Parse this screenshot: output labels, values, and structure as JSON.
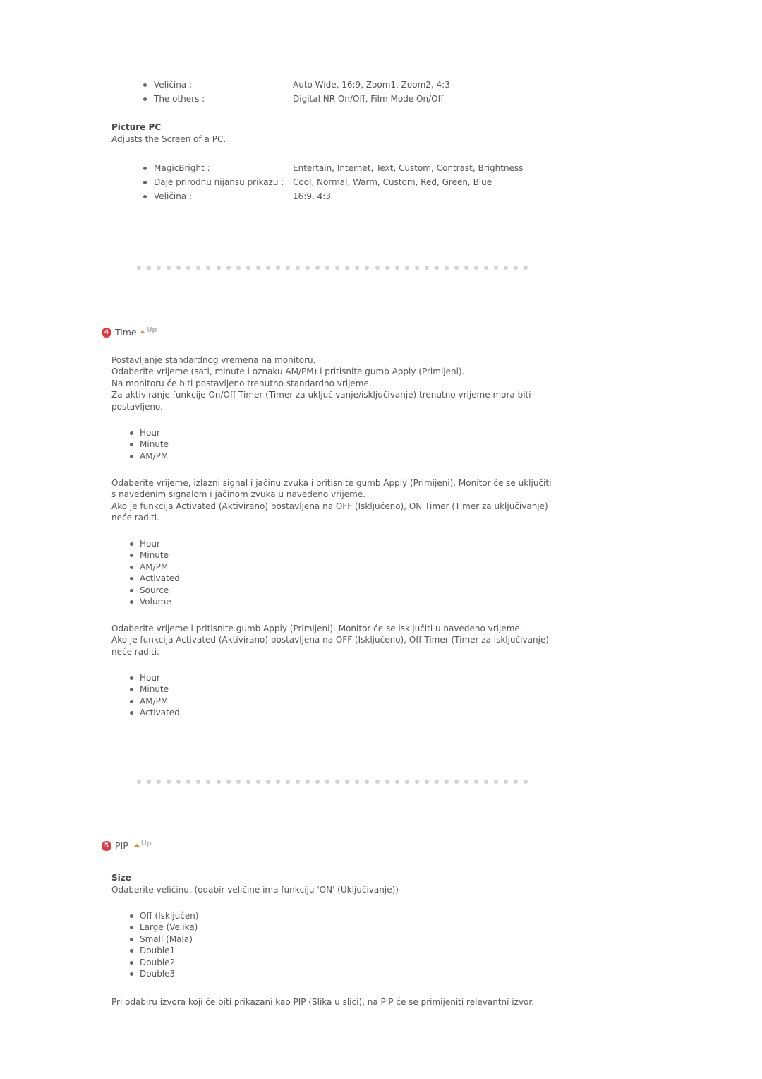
{
  "picture_top": {
    "items": [
      {
        "label": "Veličina :",
        "value": "Auto Wide, 16:9, Zoom1, Zoom2, 4:3"
      },
      {
        "label": "The others :",
        "value": "Digital NR On/Off, Film Mode On/Off"
      }
    ]
  },
  "picture_pc": {
    "title": "Picture PC",
    "description": "Adjusts the Screen of a PC.",
    "items": [
      {
        "label": "MagicBright :",
        "value": "Entertain, Internet, Text, Custom, Contrast, Brightness"
      },
      {
        "label": "Daje prirodnu nijansu prikazu :",
        "value": "Cool, Normal, Warm, Custom, Red, Green, Blue"
      },
      {
        "label": "Veličina :",
        "value": "16:9, 4:3"
      }
    ]
  },
  "time_section": {
    "number": "4",
    "title": "Time",
    "up_label": "Up",
    "intro": [
      "Postavljanje standardnog vremena na monitoru.",
      "Odaberite vrijeme (sati, minute i oznaku AM/PM) i pritisnite gumb Apply (Primijeni).",
      "Na monitoru će biti postavljeno trenutno standardno vrijeme.",
      "Za aktiviranje funkcije On/Off Timer (Timer za uključivanje/isključivanje) trenutno vrijeme mora biti postavljeno."
    ],
    "list1": [
      "Hour",
      "Minute",
      "AM/PM"
    ],
    "on_timer_text": [
      "Odaberite vrijeme, izlazni signal i jačinu zvuka i pritisnite gumb Apply (Primijeni). Monitor će se uključiti s navedenim signalom i jačinom zvuka u navedeno vrijeme.",
      "Ako je funkcija Activated (Aktivirano) postavljena na OFF (Isključeno), ON Timer (Timer za uključivanje) neće raditi."
    ],
    "list2": [
      "Hour",
      "Minute",
      "AM/PM",
      "Activated",
      "Source",
      "Volume"
    ],
    "off_timer_text": [
      "Odaberite vrijeme i pritisnite gumb Apply (Primijeni). Monitor će se isključiti u navedeno vrijeme.",
      "Ako je funkcija Activated (Aktivirano) postavljena na OFF (Isključeno), Off Timer (Timer za isključivanje) neće raditi."
    ],
    "list3": [
      "Hour",
      "Minute",
      "AM/PM",
      "Activated"
    ]
  },
  "pip_section": {
    "number": "5",
    "title": "PIP",
    "up_label": "Up",
    "size_title": "Size",
    "size_description": "Odaberite veličinu. (odabir veličine ima funkciju 'ON' (Uključivanje))",
    "size_options": [
      "Off (Isključen)",
      "Large (Velika)",
      "Small (Mala)",
      "Double1",
      "Double2",
      "Double3"
    ],
    "footer_text": "Pri odabiru izvora koji će biti prikazani kao PIP (Slika u slici), na PIP će se primijeniti relevantni izvor."
  },
  "colors": {
    "section_icon": "#e0393e",
    "up_arrow": "#e8862a",
    "separator_dot": "#d2d2d2",
    "text": "#555555"
  }
}
